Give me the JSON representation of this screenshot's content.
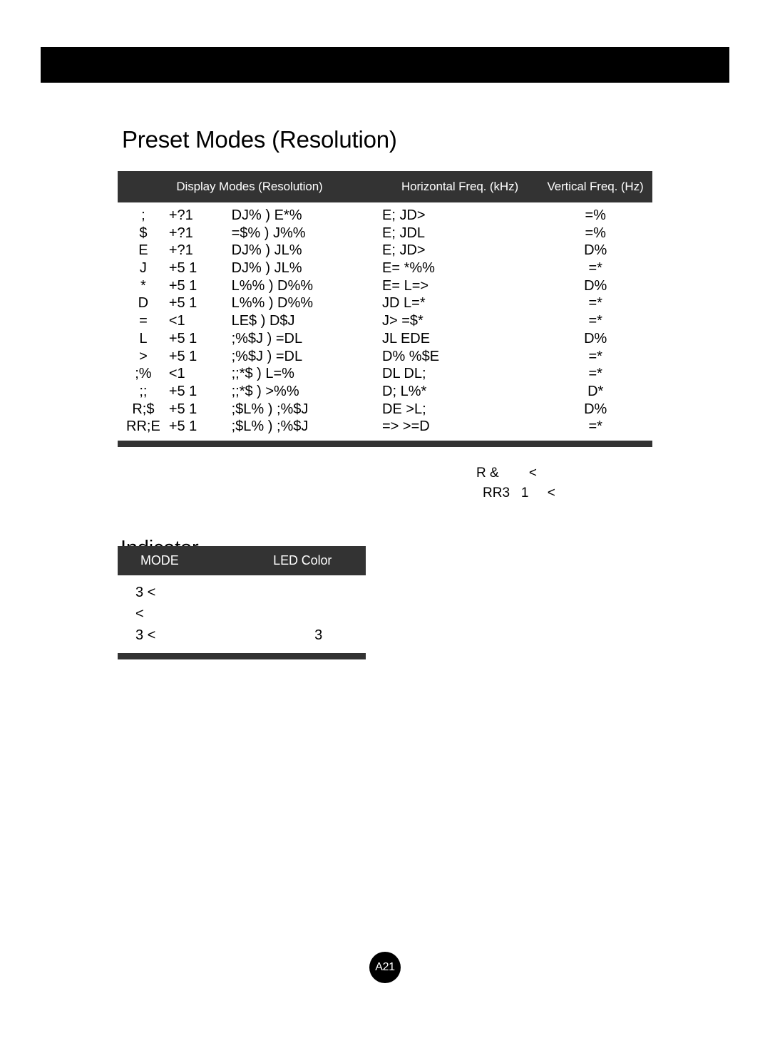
{
  "page": {
    "badge": "A21",
    "banner_color": "#000000",
    "header_bar_color": "#333333",
    "background": "#ffffff"
  },
  "preset_section": {
    "title": "Preset Modes (Resolution)",
    "table": {
      "headers": {
        "display_modes": "Display Modes (Resolution)",
        "horizontal_freq": "Horizontal Freq. (kHz)",
        "vertical_freq": "Vertical Freq. (Hz)"
      },
      "rows": [
        {
          "index": ";",
          "standard": "+?1",
          "resolution": "DJ% ) E*%",
          "hfreq": "E; JD>",
          "vfreq": "=%"
        },
        {
          "index": "$",
          "standard": "+?1",
          "resolution": "=$% ) J%%",
          "hfreq": "E; JDL",
          "vfreq": "=%"
        },
        {
          "index": "E",
          "standard": "+?1",
          "resolution": "DJ% ) JL%",
          "hfreq": "E; JD>",
          "vfreq": "D%"
        },
        {
          "index": "J",
          "standard": "+5 1",
          "resolution": "DJ% ) JL%",
          "hfreq": "E= *%%",
          "vfreq": "=*"
        },
        {
          "index": "*",
          "standard": "+5 1",
          "resolution": "L%% ) D%%",
          "hfreq": "E= L=>",
          "vfreq": "D%"
        },
        {
          "index": "D",
          "standard": "+5 1",
          "resolution": "L%% ) D%%",
          "hfreq": "JD L=*",
          "vfreq": "=*"
        },
        {
          "index": "=",
          "standard": "<1",
          "resolution": "LE$ ) D$J",
          "hfreq": "J> =$*",
          "vfreq": "=*"
        },
        {
          "index": "L",
          "standard": "+5 1",
          "resolution": ";%$J ) =DL",
          "hfreq": "JL EDE",
          "vfreq": "D%"
        },
        {
          "index": ">",
          "standard": "+5 1",
          "resolution": ";%$J ) =DL",
          "hfreq": "D% %$E",
          "vfreq": "=*"
        },
        {
          "index": ";%",
          "standard": "<1",
          "resolution": ";;*$ ) L=%",
          "hfreq": "DL DL;",
          "vfreq": "=*"
        },
        {
          "index": ";;",
          "standard": "+5 1",
          "resolution": ";;*$ ) >%%",
          "hfreq": "D; L%*",
          "vfreq": "D*"
        },
        {
          "index": "R;$",
          "standard": "+5 1",
          "resolution": ";$L% ) ;%$J",
          "hfreq": "DE >L;",
          "vfreq": "D%"
        },
        {
          "index": "RR;E",
          "standard": "+5 1",
          "resolution": ";$L% ) ;%$J",
          "hfreq": "=> >=D",
          "vfreq": "=*"
        }
      ]
    },
    "footnote": [
      "R &        <",
      "RR3   1     <"
    ]
  },
  "indicator_section": {
    "title": "Indicator",
    "table": {
      "headers": {
        "mode": "MODE",
        "led_color": "LED Color"
      },
      "rows": [
        {
          "mode": "3  <",
          "led": ""
        },
        {
          "mode": "   <",
          "led": ""
        },
        {
          "mode": "3  <",
          "led": "3"
        }
      ]
    }
  }
}
